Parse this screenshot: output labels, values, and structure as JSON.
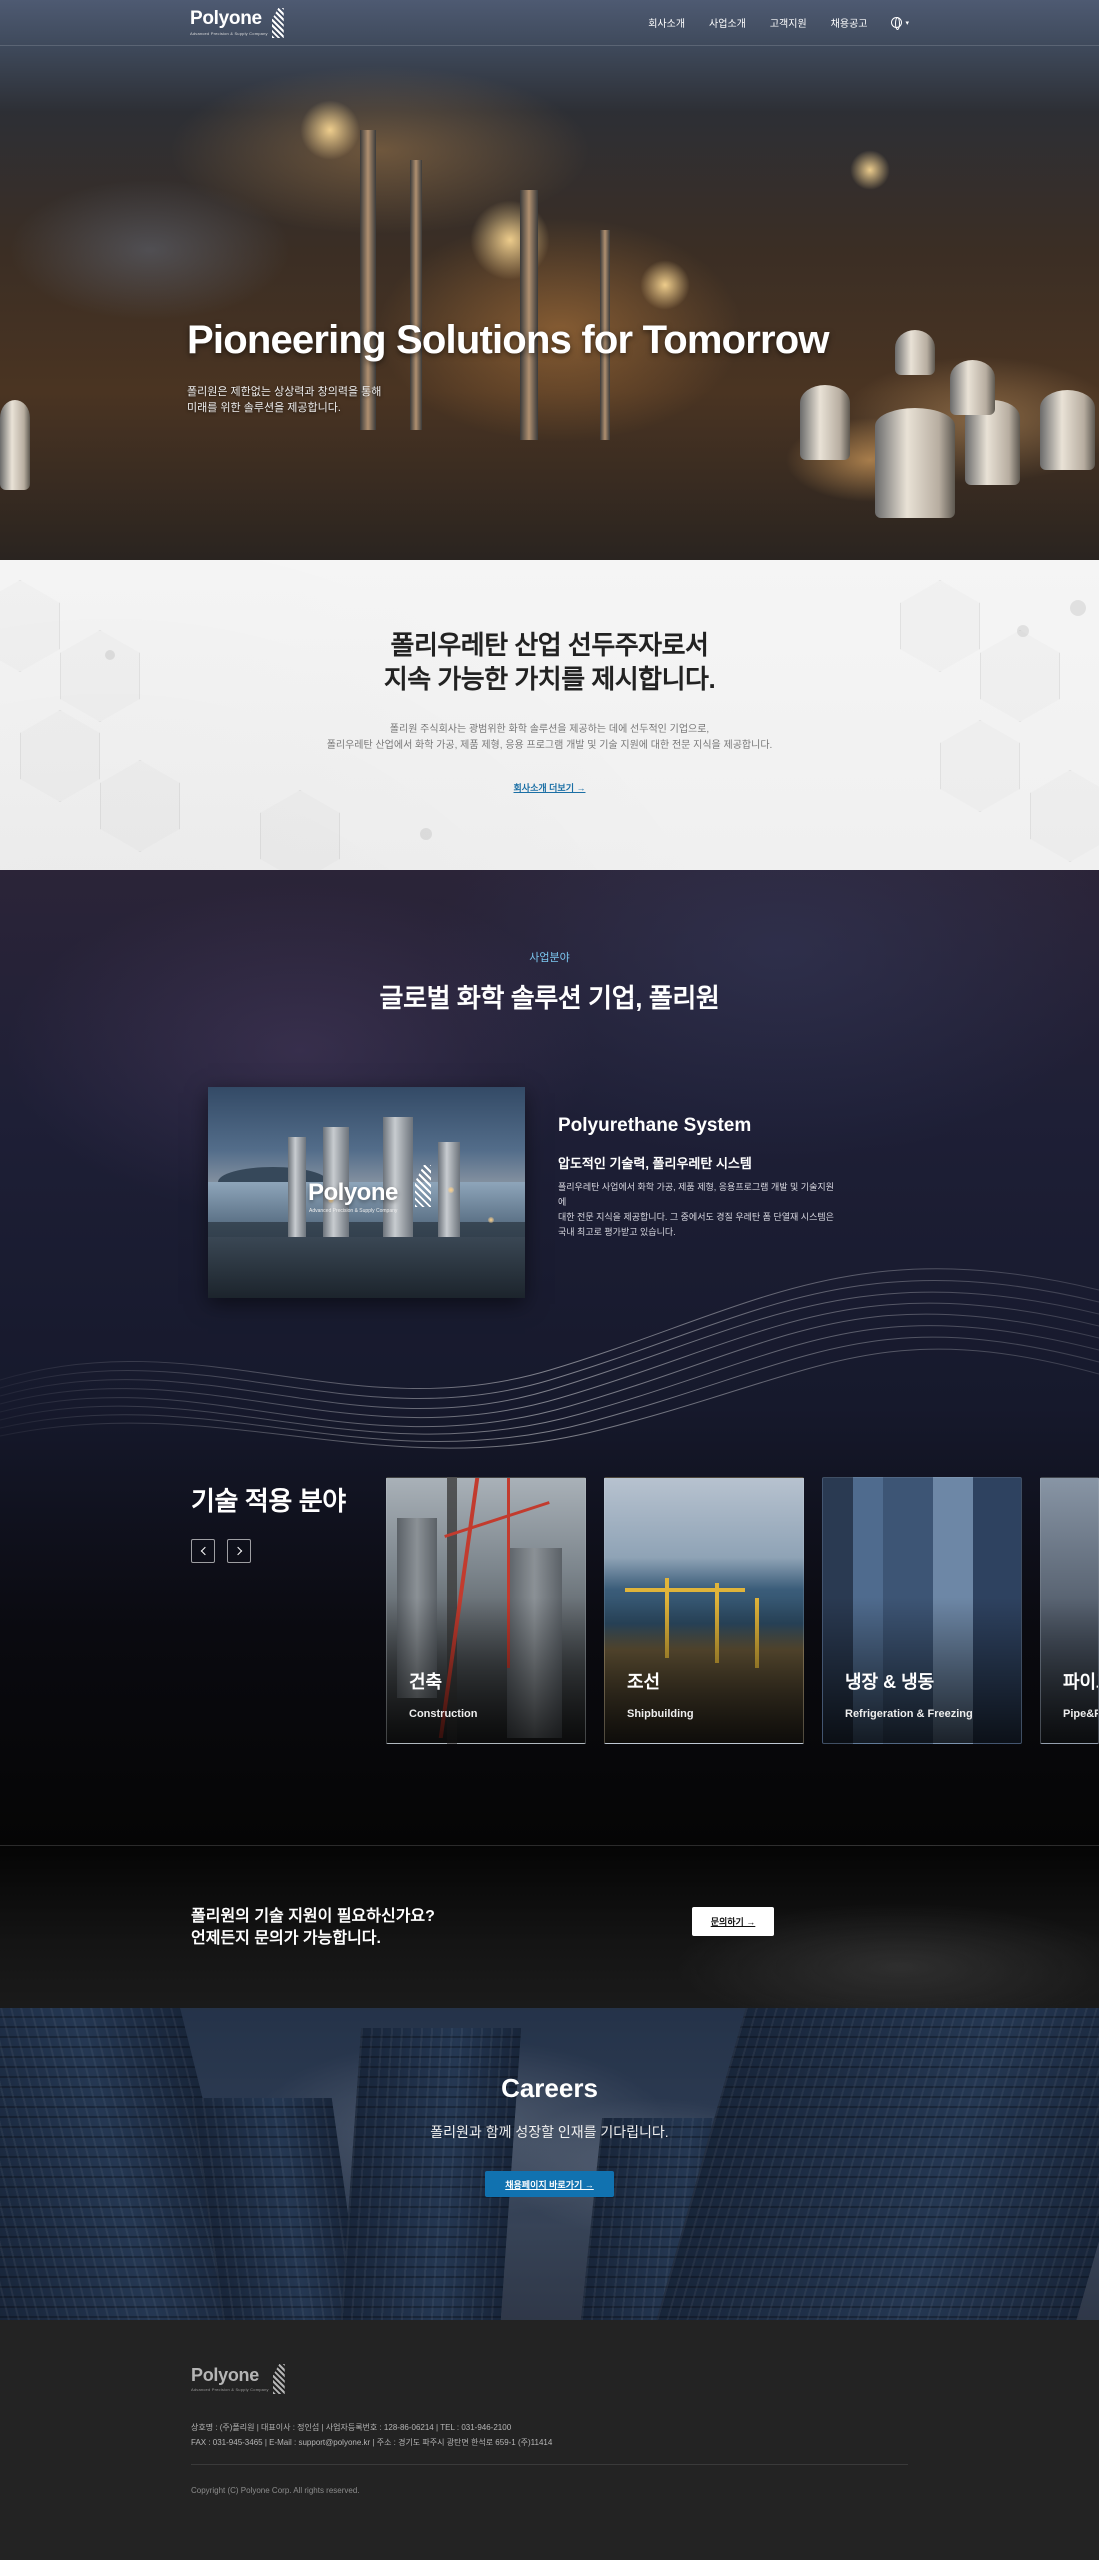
{
  "header": {
    "logo": "Polyone",
    "logo_sub": "Advanced Precision & Supply Company",
    "nav": [
      "회사소개",
      "사업소개",
      "고객지원",
      "채용공고"
    ]
  },
  "hero": {
    "title": "Pioneering Solutions for Tomorrow",
    "desc_line1": "폴리원은 제한없는 상상력과 창의력을 통해",
    "desc_line2": "미래를 위한 솔루션을 제공합니다."
  },
  "intro": {
    "title_line1": "폴리우레탄 산업 선두주자로서",
    "title_line2": "지속 가능한 가치를 제시합니다.",
    "desc_line1": "폴리원 주식회사는 광범위한 화학 솔루션을 제공하는 데에 선두적인 기업으로,",
    "desc_line2": "폴리우레탄 산업에서 화학 가공, 제품 제형, 응용 프로그램 개발 및 기술 지원에 대한 전문 지식을 제공합니다.",
    "link": "회사소개 더보기 →"
  },
  "business": {
    "label": "사업분야",
    "title": "글로벌 화학 솔루션 기업, 폴리원",
    "image_logo": "Polyone",
    "image_logo_sub": "Advanced Precision & Supply Company",
    "name": "Polyurethane System",
    "subtitle": "압도적인 기술력, 폴리우레탄 시스템",
    "text_line1": "폴리우레탄 사업에서 화학 가공, 제품 제형, 응용프로그램 개발 및 기술지원에",
    "text_line2": "대한 전문 지식을 제공합니다. 그 중에서도 경질 우레탄 폼 단열재 시스템은",
    "text_line3": "국내 최고로 평가받고 있습니다."
  },
  "tech": {
    "title": "기술 적용 분야",
    "cards": [
      {
        "title": "건축",
        "sub": "Construction"
      },
      {
        "title": "조선",
        "sub": "Shipbuilding"
      },
      {
        "title": "냉장 & 냉동",
        "sub": "Refrigeration & Freezing"
      },
      {
        "title": "파이프",
        "sub": "Pipe&P"
      }
    ]
  },
  "cta": {
    "title_line1": "폴리원의 기술 지원이 필요하신가요?",
    "title_line2": "언제든지 문의가 가능합니다.",
    "button": "문의하기 →"
  },
  "careers": {
    "title": "Careers",
    "subtitle": "폴리원과 함께 성장할 인재를 기다립니다.",
    "button": "채용페이지 바로가기 →"
  },
  "footer": {
    "logo": "Polyone",
    "logo_sub": "Advanced Precision & Supply Company",
    "info_line1": "상호명 : (주)폴리원  |  대표이사 : 정인섭  |  사업자등록번호 : 128-86-06214  |  TEL : 031-946-2100",
    "info_line2": "FAX : 031-945-3465  |  E-Mail : support@polyone.kr  |  주소 : 경기도 파주시 광탄면 한석로 659-1 (주)11414",
    "copyright": "Copyright (C) Polyone Corp. All rights reserved."
  }
}
